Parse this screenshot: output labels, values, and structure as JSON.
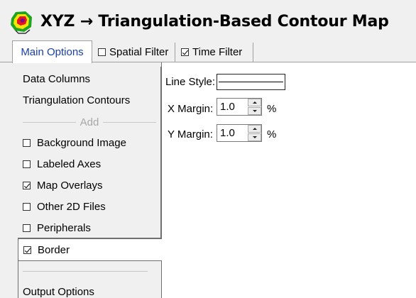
{
  "window": {
    "title": "XYZ → Triangulation-Based Contour Map",
    "icon": "contour-map-app-icon"
  },
  "tabs": [
    {
      "label": "Main Options",
      "active": true
    },
    {
      "label": "Spatial Filter",
      "checked": false
    },
    {
      "label": "Time Filter",
      "checked": true
    }
  ],
  "sidebar": {
    "items": [
      {
        "label": "Data Columns"
      },
      {
        "label": "Triangulation Contours"
      }
    ],
    "add_label": "Add",
    "optional_items": [
      {
        "label": "Background Image",
        "checked": false
      },
      {
        "label": "Labeled Axes",
        "checked": false
      },
      {
        "label": "Map Overlays",
        "checked": true
      },
      {
        "label": "Other 2D Files",
        "checked": false
      },
      {
        "label": "Peripherals",
        "checked": false
      },
      {
        "label": "Border",
        "checked": true,
        "selected": true
      }
    ],
    "output_label": "Output Options"
  },
  "main": {
    "line_style_label": "Line Style:",
    "x_margin_label": "X Margin:",
    "x_margin_value": "1.0",
    "x_margin_unit": "%",
    "y_margin_label": "Y Margin:",
    "y_margin_value": "1.0",
    "y_margin_unit": "%"
  },
  "colors": {
    "active_tab_text": "#1a3fa8",
    "background": "#f0f0f0",
    "panel": "#ffffff"
  }
}
